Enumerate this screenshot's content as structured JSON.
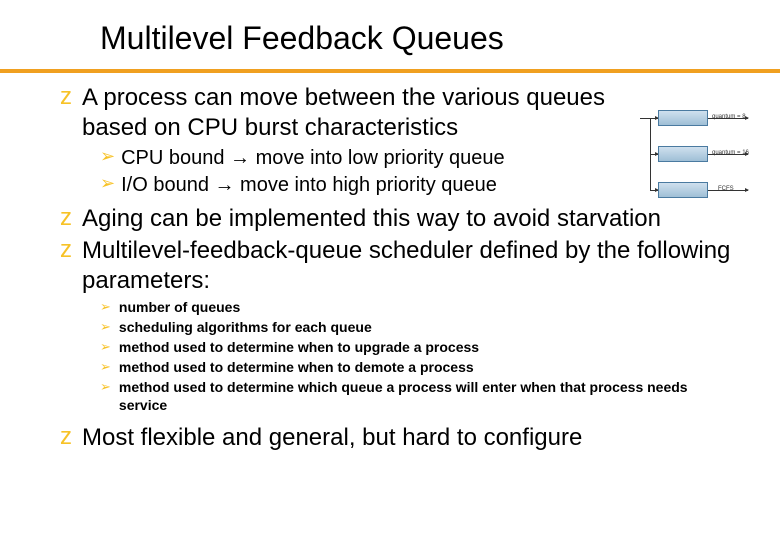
{
  "title": "Multilevel Feedback Queues",
  "bullets": {
    "b1": "A process can move between the various queues based on CPU burst characteristics",
    "b1_sub": {
      "s1": "CPU bound → move into low priority queue",
      "s2": "I/O bound → move into high priority queue"
    },
    "b2": "Aging can be implemented this way to avoid starvation",
    "b3": "Multilevel-feedback-queue scheduler defined by the following parameters:",
    "b3_sub": {
      "s1": "number of queues",
      "s2": "scheduling algorithms for each queue",
      "s3": "method used to determine when to upgrade a process",
      "s4": "method used to determine when to demote a process",
      "s5": "method used to determine which queue a process will enter when that process needs service"
    },
    "b4": "Most flexible and general, but hard to configure"
  },
  "diagram": {
    "q1_label": "quantum = 8",
    "q2_label": "quantum = 16",
    "q3_label": "FCFS"
  },
  "glyphs": {
    "z": "z",
    "tri": "➢"
  }
}
